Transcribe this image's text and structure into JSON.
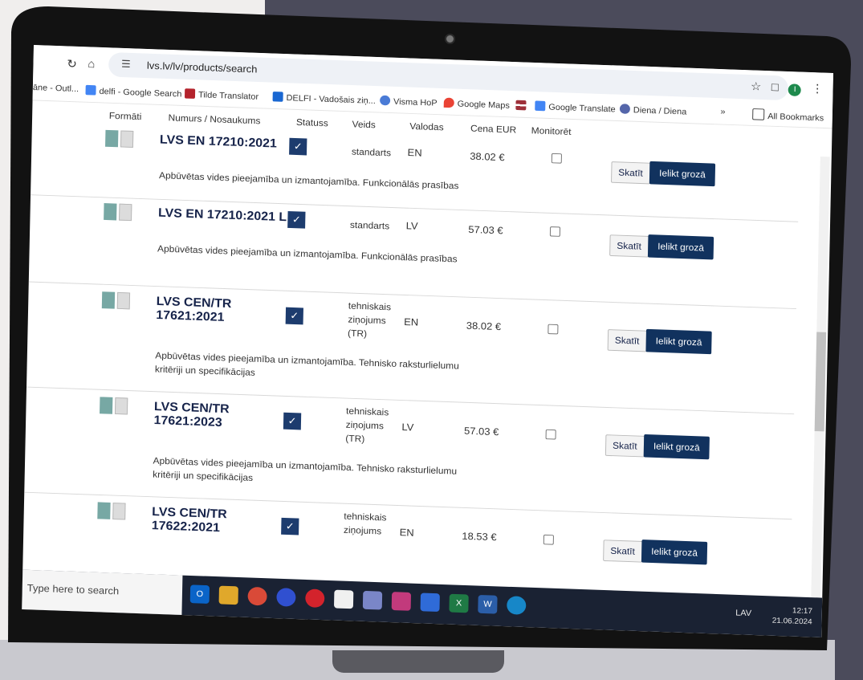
{
  "browser": {
    "url": "lvs.lv/lv/products/search",
    "bookmarks": [
      "āne - Outl...",
      "delfi - Google Search",
      "Tilde Translator",
      "DELFI - Vadošais ziņ...",
      "Visma HoP",
      "Google Maps",
      "Google Translate",
      "Diena / Diena"
    ],
    "all_bookmarks": "All Bookmarks",
    "profile_initial": "I"
  },
  "table": {
    "headers": [
      "Formāti",
      "Numurs / Nosaukums",
      "Statuss",
      "Veids",
      "Valodas",
      "Cena EUR",
      "Monitorēt"
    ],
    "view_label": "Skatīt",
    "cart_label": "Ielikt grozā",
    "rows": [
      {
        "title": "LVS EN 17210:2021",
        "kind": "standarts",
        "lang": "EN",
        "price": "38.02 €",
        "desc": "Apbūvētas vides pieejamība un izmantojamība. Funkcionālās prasības"
      },
      {
        "title": "LVS EN 17210:2021 L",
        "kind": "standarts",
        "lang": "LV",
        "price": "57.03 €",
        "desc": "Apbūvētas vides pieejamība un izmantojamība. Funkcionālās prasības"
      },
      {
        "title": "LVS CEN/TR 17621:2021",
        "kind": "tehniskais ziņojums (TR)",
        "lang": "EN",
        "price": "38.02 €",
        "desc": "Apbūvētas vides pieejamība un izmantojamība. Tehnisko raksturlielumu kritēriji un specifikācijas"
      },
      {
        "title": "LVS CEN/TR 17621:2023",
        "kind": "tehniskais ziņojums (TR)",
        "lang": "LV",
        "price": "57.03 €",
        "desc": "Apbūvētas vides pieejamība un izmantojamība. Tehnisko raksturlielumu kritēriji un specifikācijas"
      },
      {
        "title": "LVS CEN/TR 17622:2021",
        "kind": "tehniskais ziņojums",
        "lang": "EN",
        "price": "18.53 €",
        "desc": ""
      }
    ]
  },
  "taskbar": {
    "search_placeholder": "Type here to search",
    "language": "LAV",
    "time": "12:17",
    "date": "21.06.2024"
  }
}
